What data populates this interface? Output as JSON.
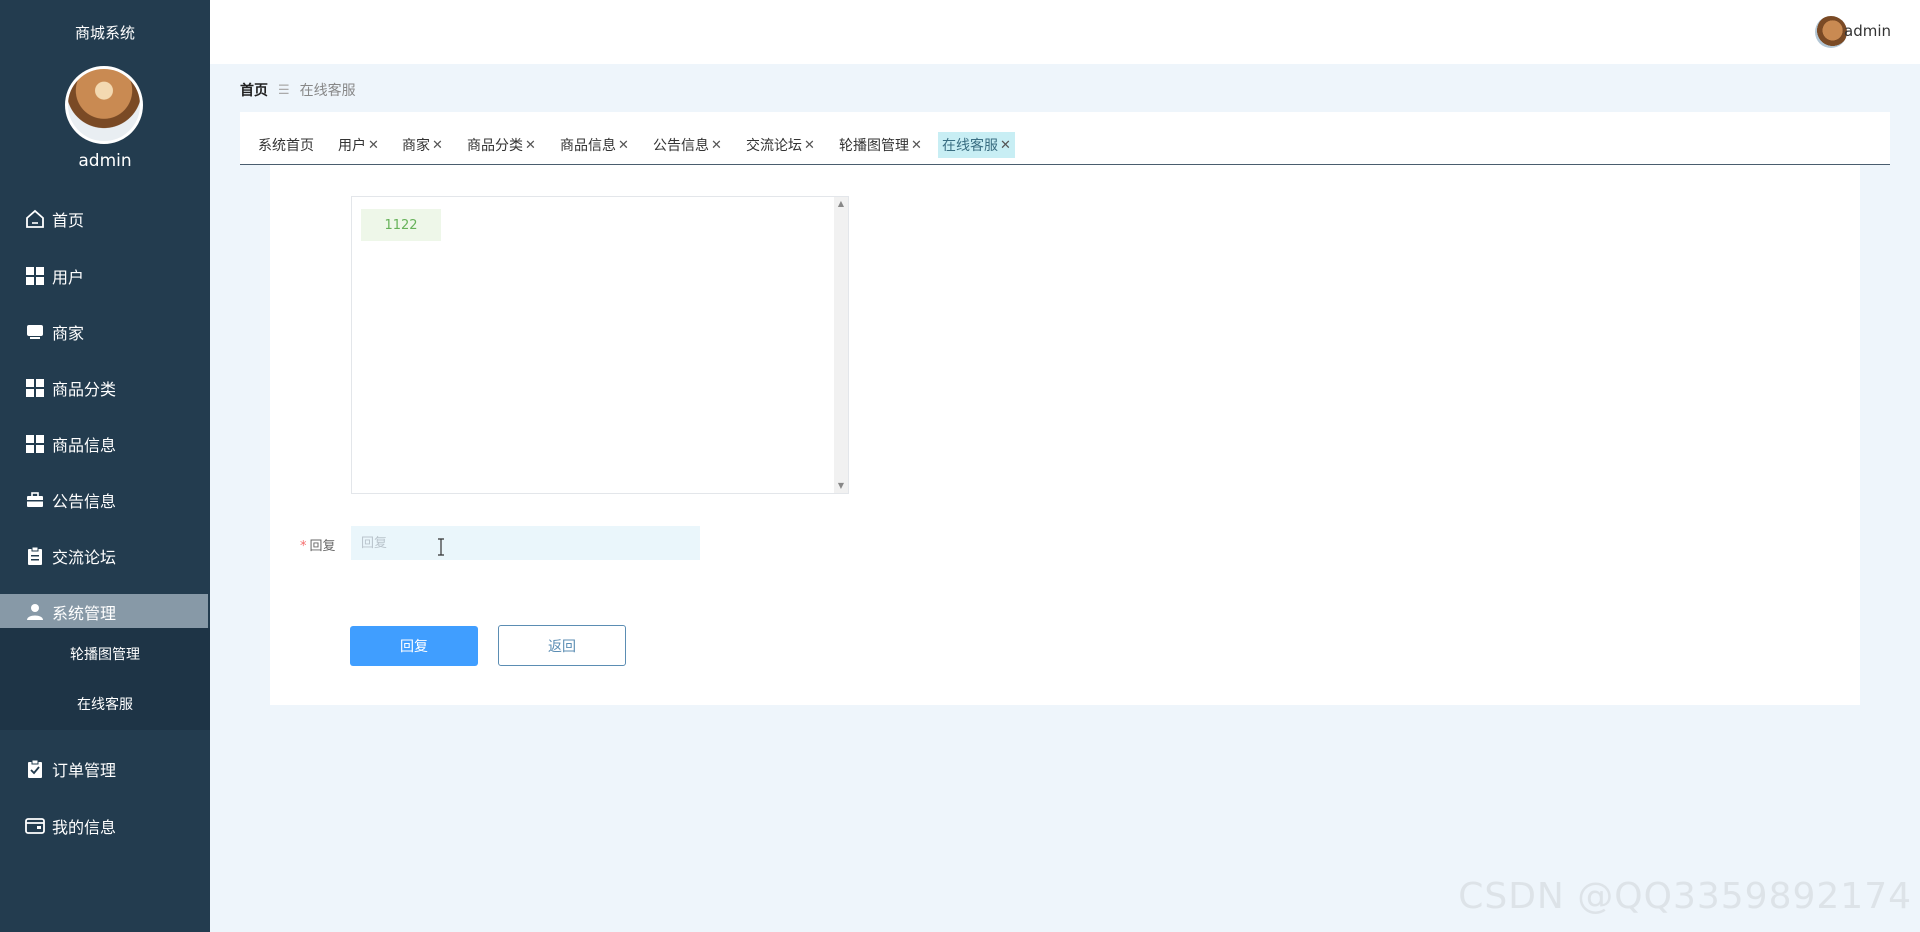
{
  "app": {
    "title": "商城系统",
    "user": "admin"
  },
  "sidebar": {
    "items": [
      {
        "label": "首页",
        "icon": "home-icon"
      },
      {
        "label": "用户",
        "icon": "grid-icon"
      },
      {
        "label": "商家",
        "icon": "monitor-icon"
      },
      {
        "label": "商品分类",
        "icon": "grid-icon"
      },
      {
        "label": "商品信息",
        "icon": "grid-icon"
      },
      {
        "label": "公告信息",
        "icon": "briefcase-icon"
      },
      {
        "label": "交流论坛",
        "icon": "clipboard-icon"
      },
      {
        "label": "系统管理",
        "icon": "user-icon"
      },
      {
        "label": "订单管理",
        "icon": "checklist-icon"
      },
      {
        "label": "我的信息",
        "icon": "wallet-icon"
      }
    ],
    "submenu": [
      "轮播图管理",
      "在线客服"
    ]
  },
  "header": {
    "user": "admin"
  },
  "breadcrumb": {
    "home": "首页",
    "separator": "☰",
    "current": "在线客服"
  },
  "tabs": [
    {
      "label": "系统首页",
      "closable": false
    },
    {
      "label": "用户",
      "closable": true
    },
    {
      "label": "商家",
      "closable": true
    },
    {
      "label": "商品分类",
      "closable": true
    },
    {
      "label": "商品信息",
      "closable": true
    },
    {
      "label": "公告信息",
      "closable": true
    },
    {
      "label": "交流论坛",
      "closable": true
    },
    {
      "label": "轮播图管理",
      "closable": true
    },
    {
      "label": "在线客服",
      "closable": true,
      "active": true
    }
  ],
  "chat": {
    "messages": [
      "1122"
    ]
  },
  "form": {
    "reply_label": "回复",
    "required_mark": "*",
    "reply_placeholder": "回复",
    "reply_value": ""
  },
  "buttons": {
    "submit": "回复",
    "back": "返回"
  },
  "watermark": "CSDN @QQ3359892174",
  "colors": {
    "sidebar": "#233c4f",
    "primary": "#409eff",
    "active_tab": "#c8eef4"
  }
}
